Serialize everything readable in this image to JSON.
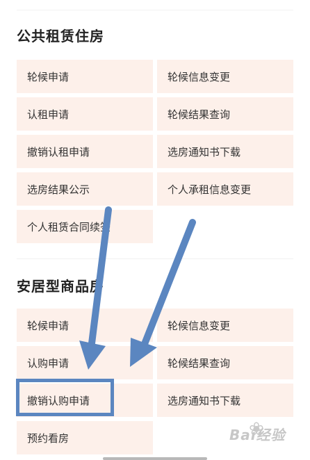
{
  "public_rental": {
    "title": "公共租赁住房",
    "items": [
      "轮候申请",
      "轮候信息变更",
      "认租申请",
      "轮候结果查询",
      "撤销认租申请",
      "选房通知书下载",
      "选房结果公示",
      "个人承租信息变更",
      "个人租赁合同续签"
    ]
  },
  "affordable_housing": {
    "title": "安居型商品房",
    "items": [
      "轮候申请",
      "轮候信息变更",
      "认购申请",
      "轮候结果查询",
      "撤销认购申请",
      "选房通知书下载",
      "预约看房"
    ]
  },
  "annotation": {
    "arrow_color": "#5b86c0",
    "highlighted_item": "撤销认购申请"
  },
  "watermark": {
    "text": "Bai经验"
  }
}
